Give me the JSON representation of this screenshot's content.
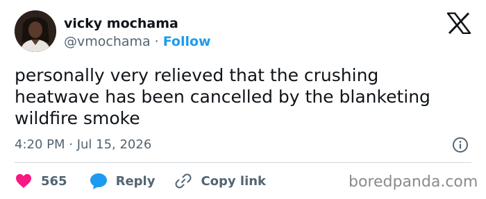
{
  "author": {
    "name": "vicky mochama",
    "handle": "@vmochama",
    "separator": "·",
    "follow_label": "Follow"
  },
  "tweet": {
    "text": "personally very relieved that the crushing\nheatwave has been cancelled by the blanketing\nwildfire smoke",
    "timestamp": "4:20 PM · Jul 15, 2026"
  },
  "actions": {
    "likes_count": "565",
    "reply_label": "Reply",
    "copy_link_label": "Copy link"
  },
  "watermark": "boredpanda.com",
  "colors": {
    "accent": "#1d9bf0",
    "like": "#f91880",
    "text": "#0f1419",
    "muted": "#536471"
  },
  "icons": {
    "logo": "x-logo-icon",
    "info": "info-icon",
    "like": "heart-icon",
    "reply": "speech-bubble-icon",
    "copy": "link-icon"
  }
}
